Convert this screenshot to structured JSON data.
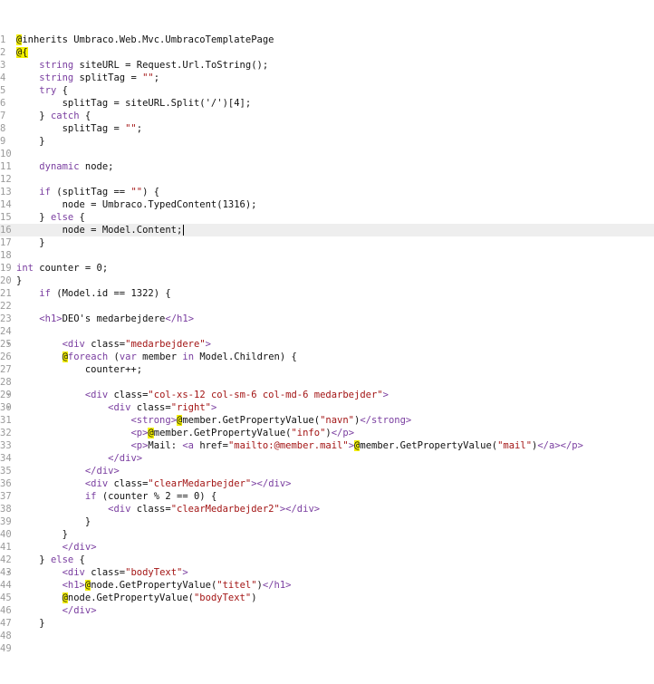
{
  "lines": [
    {
      "n": "1",
      "t": "@inherits Umbraco.Web.Mvc.UmbracoTemplatePage"
    },
    {
      "n": "2",
      "t": "@{"
    },
    {
      "n": "3",
      "t": "    string siteURL = Request.Url.ToString();"
    },
    {
      "n": "4",
      "t": "    string splitTag = \"\";"
    },
    {
      "n": "5",
      "t": "    try {"
    },
    {
      "n": "6",
      "t": "        splitTag = siteURL.Split('/')[4];"
    },
    {
      "n": "7",
      "t": "    } catch {"
    },
    {
      "n": "8",
      "t": "        splitTag = \"\";"
    },
    {
      "n": "9",
      "t": "    }"
    },
    {
      "n": "10",
      "t": ""
    },
    {
      "n": "11",
      "t": "    dynamic node;"
    },
    {
      "n": "12",
      "t": ""
    },
    {
      "n": "13",
      "t": "    if (splitTag == \"\") {"
    },
    {
      "n": "14",
      "t": "        node = Umbraco.TypedContent(1316);"
    },
    {
      "n": "15",
      "t": "    } else {"
    },
    {
      "n": "16",
      "t": "        node = Model.Content;"
    },
    {
      "n": "17",
      "t": "    }"
    },
    {
      "n": "18",
      "t": ""
    },
    {
      "n": "19",
      "t": "int counter = 0;"
    },
    {
      "n": "20",
      "t": "}"
    },
    {
      "n": "21",
      "t": "    if (Model.id == 1322) {"
    },
    {
      "n": "22",
      "t": ""
    },
    {
      "n": "23",
      "t": "    <h1>DEO's medarbejdere</h1>"
    },
    {
      "n": "24",
      "t": ""
    },
    {
      "n": "25",
      "t": "        <div class=\"medarbejdere\">"
    },
    {
      "n": "26",
      "t": "        @foreach (var member in Model.Children) {"
    },
    {
      "n": "27",
      "t": "            counter++;"
    },
    {
      "n": "28",
      "t": ""
    },
    {
      "n": "29",
      "t": "            <div class=\"col-xs-12 col-sm-6 col-md-6 medarbejder\">"
    },
    {
      "n": "30",
      "t": "                <div class=\"right\">"
    },
    {
      "n": "31",
      "t": "                    <strong>@member.GetPropertyValue(\"navn\")</strong>"
    },
    {
      "n": "32",
      "t": "                    <p>@member.GetPropertyValue(\"info\")</p>"
    },
    {
      "n": "33",
      "t": "                    <p>Mail: <a href=\"mailto:@member.mail\">@member.GetPropertyValue(\"mail\")</a></p>"
    },
    {
      "n": "34",
      "t": "                </div>"
    },
    {
      "n": "35",
      "t": "            </div>"
    },
    {
      "n": "36",
      "t": "            <div class=\"clearMedarbejder\"></div>"
    },
    {
      "n": "37",
      "t": "            if (counter % 2 == 0) {"
    },
    {
      "n": "38",
      "t": "                <div class=\"clearMedarbejder2\"></div>"
    },
    {
      "n": "39",
      "t": "            }"
    },
    {
      "n": "40",
      "t": "        }"
    },
    {
      "n": "41",
      "t": "        </div>"
    },
    {
      "n": "42",
      "t": "    } else {"
    },
    {
      "n": "43",
      "t": "        <div class=\"bodyText\">"
    },
    {
      "n": "44",
      "t": "        <h1>@node.GetPropertyValue(\"titel\")</h1>"
    },
    {
      "n": "45",
      "t": "        @node.GetPropertyValue(\"bodyText\")"
    },
    {
      "n": "46",
      "t": "        </div>"
    },
    {
      "n": "47",
      "t": "    }"
    },
    {
      "n": "48",
      "t": ""
    },
    {
      "n": "49",
      "t": ""
    }
  ],
  "active_line": "16",
  "fold_lines": [
    "25",
    "29",
    "30",
    "43"
  ],
  "colors": {
    "keyword": "#7a3ea0",
    "string": "#a31515",
    "at_highlight": "#f4f000",
    "active_line_bg": "#eeeeee"
  }
}
